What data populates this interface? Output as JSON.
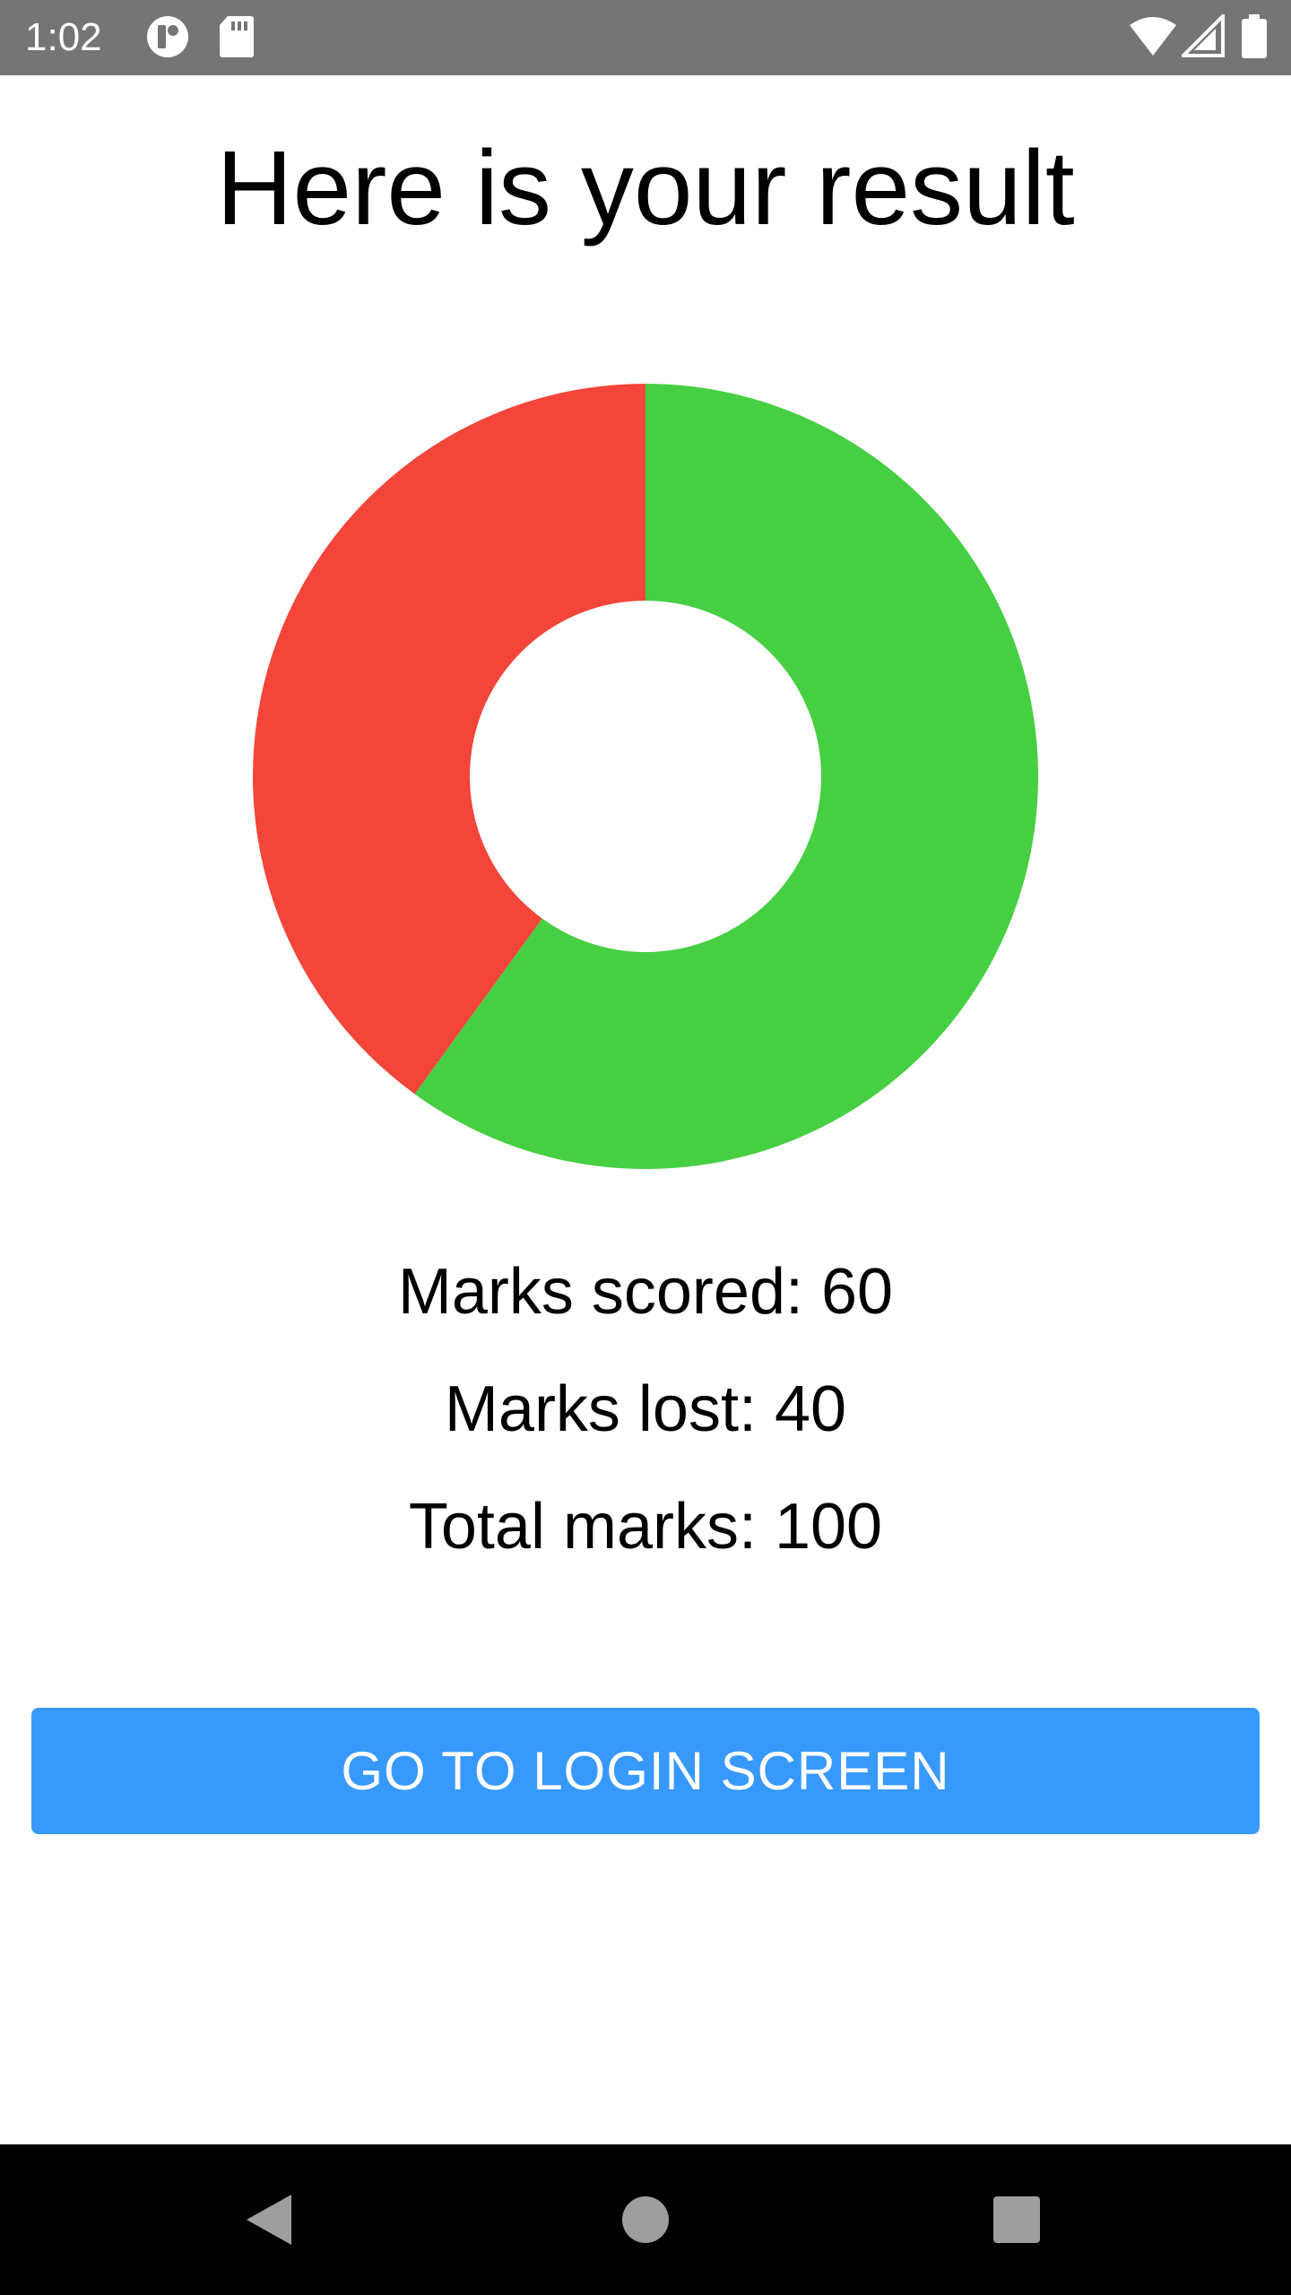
{
  "status_bar": {
    "time": "1:02",
    "icons": [
      "app-notification-icon",
      "sd-card-icon",
      "wifi-icon",
      "cell-signal-icon",
      "battery-icon"
    ]
  },
  "title": "Here is your result",
  "chart_data": {
    "type": "pie",
    "donut": true,
    "slices": [
      {
        "name": "Marks scored",
        "value": 60,
        "color": "#46cf43"
      },
      {
        "name": "Marks lost",
        "value": 40,
        "color": "#f4453a"
      }
    ],
    "start": "top",
    "direction": "clockwise"
  },
  "stats": {
    "scored": "Marks scored: 60",
    "lost": "Marks lost: 40",
    "total": "Total marks: 100"
  },
  "button": {
    "label": "GO TO LOGIN SCREEN",
    "color": "#3899fc"
  },
  "nav_bar": {
    "icons": [
      "back-icon",
      "home-icon",
      "recents-icon"
    ]
  }
}
